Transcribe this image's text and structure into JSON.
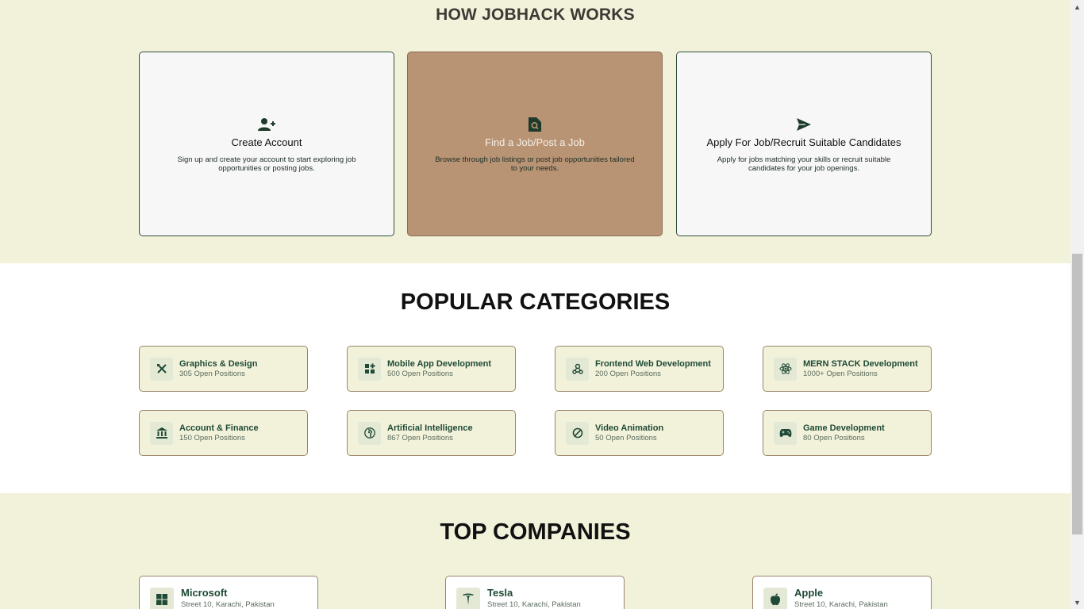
{
  "how_it_works": {
    "heading": "HOW JOBHACK WORKS",
    "cards": [
      {
        "title": "Create Account",
        "desc": "Sign up and create your account to start exploring job opportunities or posting jobs.",
        "icon": "user-plus-icon"
      },
      {
        "title": "Find a Job/Post a Job",
        "desc": "Browse through job listings or post job opportunities tailored to your needs.",
        "icon": "file-search-icon"
      },
      {
        "title": "Apply For Job/Recruit Suitable Candidates",
        "desc": "Apply for jobs matching your skills or recruit suitable candidates for your job openings.",
        "icon": "paper-plane-icon"
      }
    ]
  },
  "categories": {
    "heading": "POPULAR CATEGORIES",
    "items": [
      {
        "name": "Graphics & Design",
        "count": "305 Open Positions",
        "icon": "design-tools-icon"
      },
      {
        "name": "Mobile App Development",
        "count": "500 Open Positions",
        "icon": "apps-grid-icon"
      },
      {
        "name": "Frontend Web Development",
        "count": "200 Open Positions",
        "icon": "webhook-icon"
      },
      {
        "name": "MERN STACK Development",
        "count": "1000+ Open Positions",
        "icon": "react-atom-icon"
      },
      {
        "name": "Account & Finance",
        "count": "150 Open Positions",
        "icon": "bank-icon"
      },
      {
        "name": "Artificial Intelligence",
        "count": "867 Open Positions",
        "icon": "ai-head-icon"
      },
      {
        "name": "Video Animation",
        "count": "50 Open Positions",
        "icon": "film-reel-icon"
      },
      {
        "name": "Game Development",
        "count": "80 Open Positions",
        "icon": "gamepad-icon"
      }
    ]
  },
  "companies": {
    "heading": "TOP COMPANIES",
    "items": [
      {
        "name": "Microsoft",
        "address": "Street 10, Karachi, Pakistan",
        "icon": "microsoft-icon"
      },
      {
        "name": "Tesla",
        "address": "Street 10, Karachi, Pakistan",
        "icon": "tesla-icon"
      },
      {
        "name": "Apple",
        "address": "Street 10, Karachi, Pakistan",
        "icon": "apple-icon"
      }
    ]
  },
  "colors": {
    "section_bg": "#f2f2da",
    "accent_card": "#b89475",
    "brand_green": "#1f4a35"
  }
}
